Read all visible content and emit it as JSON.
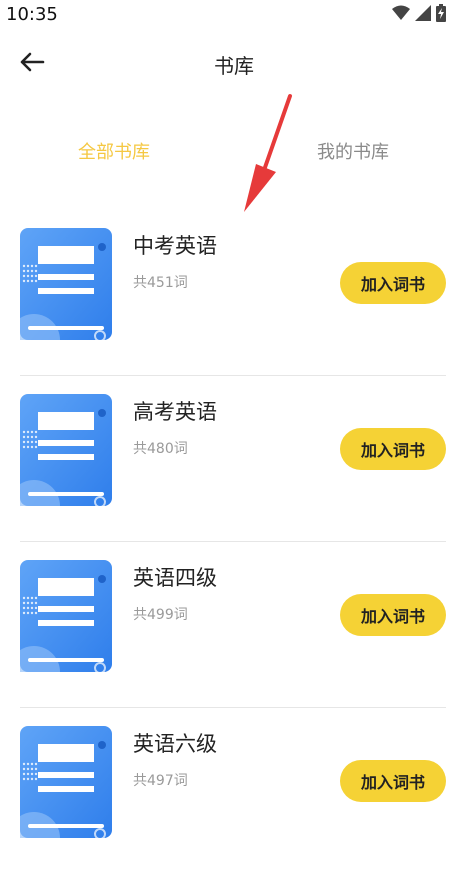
{
  "status_bar": {
    "time": "10:35"
  },
  "header": {
    "title": "书库"
  },
  "tabs": [
    {
      "label": "全部书库",
      "active": true
    },
    {
      "label": "我的书库",
      "active": false
    }
  ],
  "books": [
    {
      "title": "中考英语",
      "count": "共451词",
      "action": "加入词书"
    },
    {
      "title": "高考英语",
      "count": "共480词",
      "action": "加入词书"
    },
    {
      "title": "英语四级",
      "count": "共499词",
      "action": "加入词书"
    },
    {
      "title": "英语六级",
      "count": "共497词",
      "action": "加入词书"
    }
  ],
  "colors": {
    "accent": "#F5C842",
    "button": "#F5D235",
    "cover": "#3D8BF2",
    "annotation": "#E63A3A"
  }
}
